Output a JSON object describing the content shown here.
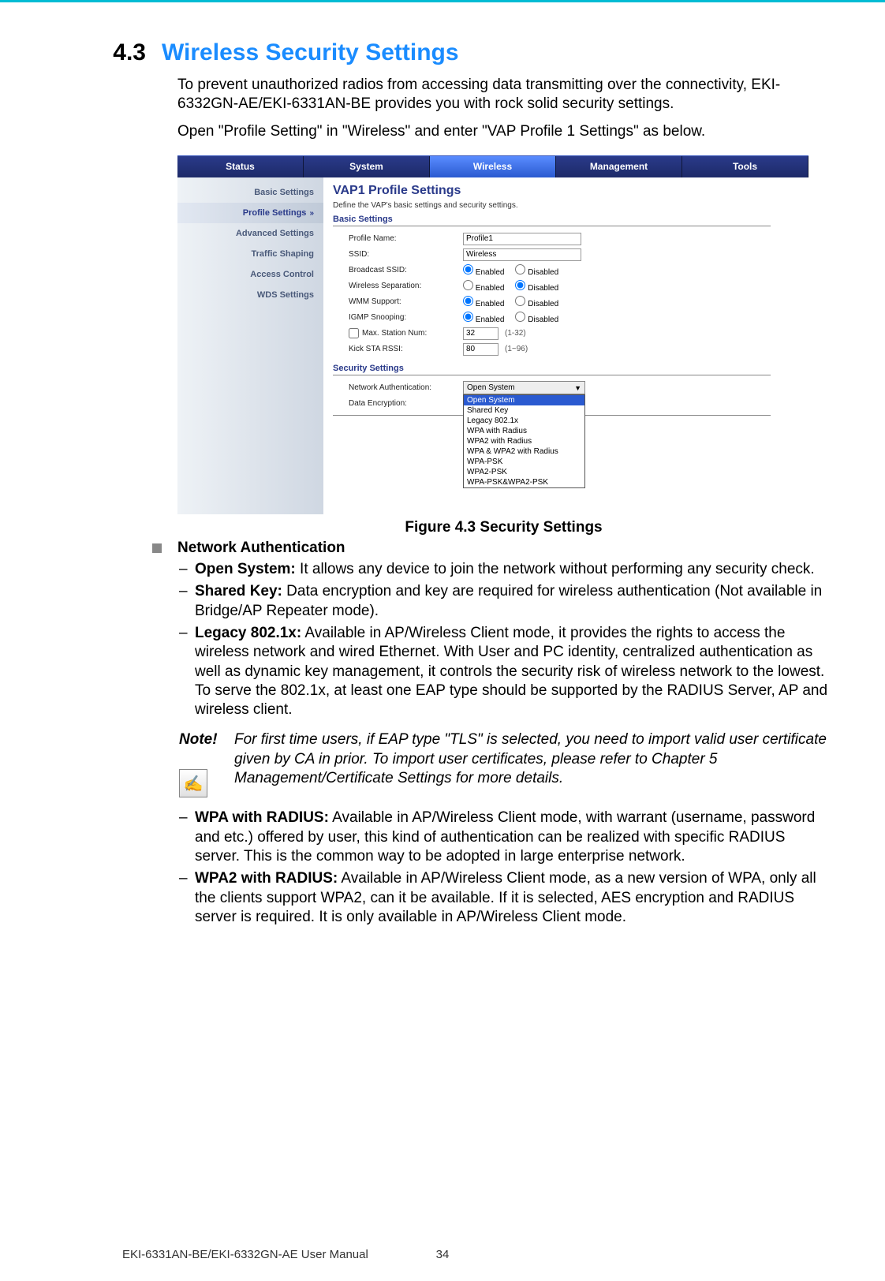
{
  "section": {
    "number": "4.3",
    "title": "Wireless Security Settings"
  },
  "intro": {
    "p1": "To prevent unauthorized radios from accessing data transmitting over the connectivity, EKI-6332GN-AE/EKI-6331AN-BE provides you with rock solid security settings.",
    "p2": "Open \"Profile Setting\" in \"Wireless\" and enter \"VAP Profile 1 Settings\" as below."
  },
  "screenshot": {
    "tabs": [
      "Status",
      "System",
      "Wireless",
      "Management",
      "Tools"
    ],
    "active_tab_index": 2,
    "sidebar": [
      "Basic Settings",
      "Profile Settings",
      "Advanced Settings",
      "Traffic Shaping",
      "Access Control",
      "WDS Settings"
    ],
    "active_sidebar_index": 1,
    "title": "VAP1 Profile Settings",
    "subtitle": "Define the VAP's basic settings and security settings.",
    "h_basic": "Basic Settings",
    "labels": {
      "profile_name": "Profile Name:",
      "ssid": "SSID:",
      "broadcast_ssid": "Broadcast SSID:",
      "wireless_sep": "Wireless Separation:",
      "wmm": "WMM Support:",
      "igmp": "IGMP Snooping:",
      "max_sta": "Max. Station Num:",
      "kick_rssi": "Kick STA RSSI:"
    },
    "values": {
      "profile_name": "Profile1",
      "ssid": "Wireless",
      "max_sta": "32",
      "max_sta_hint": "(1-32)",
      "kick_rssi": "80",
      "kick_rssi_hint": "(1~96)"
    },
    "radio": {
      "enabled": "Enabled",
      "disabled": "Disabled"
    },
    "h_security": "Security Settings",
    "sec_labels": {
      "auth": "Network Authentication:",
      "enc": "Data Encryption:"
    },
    "auth_selected": "Open System",
    "auth_options": [
      "Open System",
      "Shared Key",
      "Legacy 802.1x",
      "WPA with Radius",
      "WPA2 with Radius",
      "WPA & WPA2 with Radius",
      "WPA-PSK",
      "WPA2-PSK",
      "WPA-PSK&WPA2-PSK"
    ]
  },
  "figure_caption": "Figure 4.3 Security Settings",
  "bullet": {
    "title": "Network Authentication"
  },
  "items": {
    "open": {
      "name": "Open System:",
      "text": " It allows any device to join the network without performing any security check."
    },
    "shared": {
      "name": "Shared Key:",
      "text": " Data encryption and key are required for wireless authentication (Not available in Bridge/AP Repeater mode)."
    },
    "legacy": {
      "name": "Legacy 802.1x:",
      "text": " Available in AP/Wireless Client mode, it provides the rights to access the wireless network and wired Ethernet. With User and PC identity, centralized authentication as well as dynamic key management, it controls the security risk of wireless network to the lowest. To serve the 802.1x, at least one EAP type should be supported by the RADIUS Server, AP and wireless client."
    },
    "wpa": {
      "name": "WPA with RADIUS:",
      "text": " Available in AP/Wireless Client mode, with warrant (username, password and etc.) offered by user, this kind of authentication can be realized with specific RADIUS server. This is the common way to be adopted in large enterprise network."
    },
    "wpa2": {
      "name": "WPA2 with RADIUS:",
      "text": " Available in AP/Wireless Client mode, as a new version of WPA, only all the clients support WPA2, can it be available. If it is selected, AES encryption and RADIUS server is required.  It is only available in AP/Wireless Client mode."
    }
  },
  "note": {
    "label": "Note!",
    "text": "For first time users, if EAP type \"TLS\" is selected, you need to import valid user certificate given by CA in prior.  To import user certificates, please refer to Chapter 5 Management/Certificate Settings for more details."
  },
  "footer": {
    "manual": "EKI-6331AN-BE/EKI-6332GN-AE User Manual",
    "page": "34"
  }
}
